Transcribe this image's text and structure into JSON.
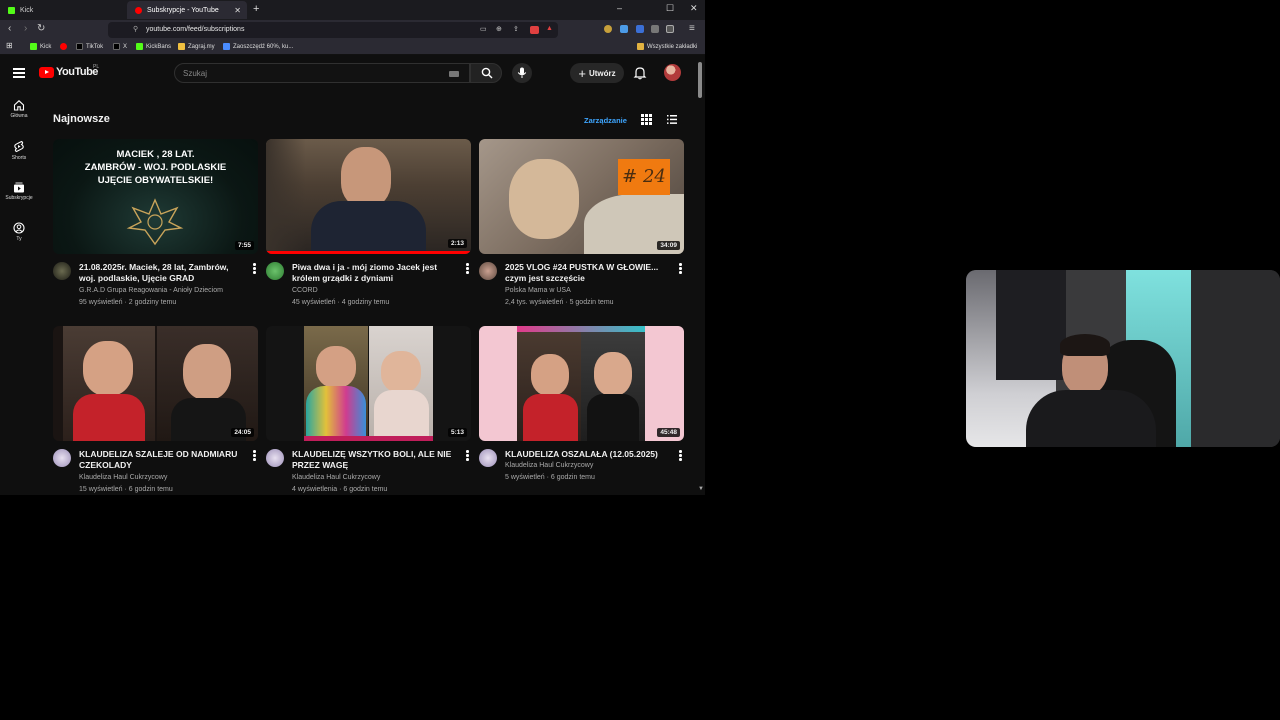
{
  "browser": {
    "tabs": [
      {
        "title": "Kick",
        "favicon_color": "#53fc18",
        "active": false
      },
      {
        "title": "Subskrypcje - YouTube",
        "favicon_color": "#ff0000",
        "active": true
      }
    ],
    "new_tab_label": "+",
    "url": "youtube.com/feed/subscriptions",
    "window_controls": [
      "–",
      "☐",
      "✕"
    ],
    "bookmarks": [
      {
        "label": "Kick",
        "color": "#53fc18"
      },
      {
        "label": "",
        "color": "#ff0000"
      },
      {
        "label": "TikTok",
        "color": "#222222"
      },
      {
        "label": "X",
        "color": "#333333"
      },
      {
        "label": "KickBans",
        "color": "#53fc18"
      },
      {
        "label": "Zagraj.my",
        "color": "#f0c040"
      },
      {
        "label": "Zaoszczędź 60%, ku...",
        "color": "#4a8cff"
      }
    ],
    "all_bookmarks_label": "Wszystkie zakładki"
  },
  "header": {
    "logo_text": "YouTube",
    "country_code": "PL",
    "search_placeholder": "Szukaj",
    "create_label": "Utwórz"
  },
  "sidebar": [
    {
      "label": "Główna",
      "icon": "home-icon"
    },
    {
      "label": "Shorts",
      "icon": "shorts-icon"
    },
    {
      "label": "Subskrypcje",
      "icon": "subscriptions-icon"
    },
    {
      "label": "Ty",
      "icon": "you-icon"
    }
  ],
  "feed": {
    "section_title": "Najnowsze",
    "manage_label": "Zarządzanie",
    "videos": [
      {
        "title": "21.08.2025r. Maciek, 28 lat, Zambrów, woj. podlaskie, Ujęcie GRAD",
        "channel": "G.R.A.D Grupa Reagowania - Anioły Dzieciom",
        "stats": "95 wyświetleń · 2 godziny temu",
        "duration": "7:55",
        "thumb_text": "MACIEK , 28 LAT.\nZAMBRÓW - WOJ. PODLASKIE\nUJĘCIE OBYWATELSKIE!"
      },
      {
        "title": "Piwa dwa i ja - mój ziomo Jacek jest królem grządki z dyniami",
        "channel": "CCORD",
        "stats": "45 wyświetleń · 4 godziny temu",
        "duration": "2:13",
        "progress": 1.0
      },
      {
        "title": "2025 VLOG #24 PUSTKA W GŁOWIE... czym jest szczęście",
        "channel": "Polska Mama w USA",
        "stats": "2,4 tys. wyświetleń · 5 godzin temu",
        "duration": "34:09",
        "thumb_text": "# 24"
      },
      {
        "title": "KLAUDELIZA SZALEJE OD NADMIARU CZEKOLADY",
        "channel": "Klaudeliza Haul Cukrzycowy",
        "stats": "15 wyświetleń · 6 godzin temu",
        "duration": "24:05"
      },
      {
        "title": "KLAUDELIZĘ WSZYTKO BOLI, ALE NIE PRZEZ WAGĘ",
        "channel": "Klaudeliza Haul Cukrzycowy",
        "stats": "4 wyświetlenia · 6 godzin temu",
        "duration": "5:13"
      },
      {
        "title": "KLAUDELIZA OSZALAŁA (12.05.2025)",
        "channel": "Klaudeliza Haul Cukrzycowy",
        "stats": "5 wyświetleń · 6 godzin temu",
        "duration": "45:48"
      }
    ]
  }
}
